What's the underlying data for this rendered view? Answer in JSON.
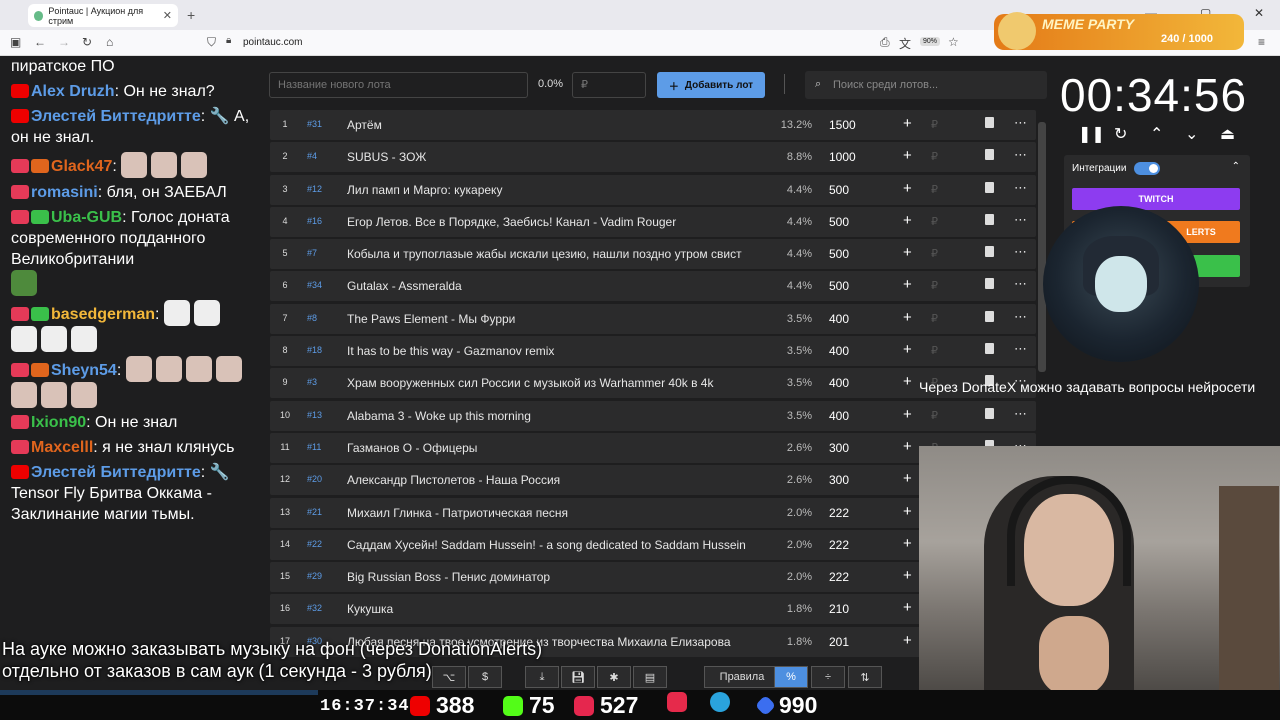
{
  "browser": {
    "tab_title": "Pointauc | Аукцион для стрим",
    "url": "pointauc.com",
    "zoom": "90%"
  },
  "chat": {
    "messages": [
      {
        "author": "",
        "text": "пиратское ПО",
        "color": "#ffffff"
      },
      {
        "author": "Alex Druzh",
        "text": "Он не знал?",
        "color": "#5d9ce7"
      },
      {
        "author": "Элестей Биттедритте",
        "text": "А, он не знал.",
        "color": "#5d9ce7"
      },
      {
        "author": "Glack47",
        "text": "",
        "color": "#e0651d"
      },
      {
        "author": "romasini",
        "text": "бля, он ЗАЕБАЛ",
        "color": "#5d9ce7"
      },
      {
        "author": "Uba-GUB",
        "text": "Голос доната современного подданного Великобритании",
        "color": "#3ac04a"
      },
      {
        "author": "basedgerman",
        "text": "",
        "color": "#f2b73a"
      },
      {
        "author": "Sheyn54",
        "text": "",
        "color": "#5d9ce7"
      },
      {
        "author": "Ixion90",
        "text": "Он не знал",
        "color": "#3ac04a"
      },
      {
        "author": "Maxcelll",
        "text": "я не знал клянусь",
        "color": "#e0651d"
      },
      {
        "author": "Элестей Биттедритте",
        "text": "Tensor Fly Бритва Оккама - Заклинание магии тьмы.",
        "color": "#5d9ce7"
      }
    ]
  },
  "toolbar": {
    "lot_placeholder": "Название нового лота",
    "percent": "0.0%",
    "amount_placeholder": "₽",
    "add_label": "Добавить лот",
    "search_placeholder": "Поиск среди лотов..."
  },
  "lots": [
    {
      "num": "1",
      "id": "#31",
      "name": "Артём",
      "pct": "13.2%",
      "amount": "1500"
    },
    {
      "num": "2",
      "id": "#4",
      "name": "SUBUS - ЗОЖ",
      "pct": "8.8%",
      "amount": "1000"
    },
    {
      "num": "3",
      "id": "#12",
      "name": "Лил памп и Марго: кукареку",
      "pct": "4.4%",
      "amount": "500"
    },
    {
      "num": "4",
      "id": "#16",
      "name": "Егор Летов. Все в Порядке, Заебись! Канал - Vadim Rouger",
      "pct": "4.4%",
      "amount": "500"
    },
    {
      "num": "5",
      "id": "#7",
      "name": "Кобыла и трупоглазые жабы искали цезию, нашли поздно утром свист",
      "pct": "4.4%",
      "amount": "500"
    },
    {
      "num": "6",
      "id": "#34",
      "name": "Gutalax - Assmeralda",
      "pct": "4.4%",
      "amount": "500"
    },
    {
      "num": "7",
      "id": "#8",
      "name": "The Paws Element - Мы Фурри",
      "pct": "3.5%",
      "amount": "400"
    },
    {
      "num": "8",
      "id": "#18",
      "name": "It has to be this way - Gazmanov remix",
      "pct": "3.5%",
      "amount": "400"
    },
    {
      "num": "9",
      "id": "#3",
      "name": "Храм вооруженных сил России с музыкой из Warhammer 40k в 4k",
      "pct": "3.5%",
      "amount": "400"
    },
    {
      "num": "10",
      "id": "#13",
      "name": "Alabama 3 - Woke up this morning",
      "pct": "3.5%",
      "amount": "400"
    },
    {
      "num": "11",
      "id": "#11",
      "name": "Газманов О - Офицеры",
      "pct": "2.6%",
      "amount": "300"
    },
    {
      "num": "12",
      "id": "#20",
      "name": "Александр Пистолетов - Наша Россия",
      "pct": "2.6%",
      "amount": "300"
    },
    {
      "num": "13",
      "id": "#21",
      "name": "Михаил Глинка - Патриотическая песня",
      "pct": "2.0%",
      "amount": "222"
    },
    {
      "num": "14",
      "id": "#22",
      "name": "Саддам Хусейн! Saddam Hussein! - a song dedicated to Saddam Hussein",
      "pct": "2.0%",
      "amount": "222"
    },
    {
      "num": "15",
      "id": "#29",
      "name": "Big Russian Boss - Пенис доминатор",
      "pct": "2.0%",
      "amount": "222"
    },
    {
      "num": "16",
      "id": "#32",
      "name": "Кукушка",
      "pct": "1.8%",
      "amount": "210"
    },
    {
      "num": "17",
      "id": "#30",
      "name": "Любая песня на твое усмотрение из творчества Михаила Елизарова",
      "pct": "1.8%",
      "amount": "201"
    }
  ],
  "bottom_bar": {
    "rules_label": "Правила"
  },
  "timer": {
    "value": "00:34:56"
  },
  "integrations": {
    "label": "Интеграции",
    "twitch_label": "TWITCH",
    "da_label": "LERTS"
  },
  "overlay": {
    "ticker": "Через DonateX можно задавать вопросы нейросети",
    "subtitle_line1": "На ауке можно заказывать музыку на фон (через DonationAlerts)",
    "subtitle_line2": "отдельно от заказов в сам аук (1 секунда - 3 рубля)",
    "meme_title": "MEME PARTY",
    "meme_count": "240 / 1000"
  },
  "statusbar": {
    "clock": "16:37:34",
    "youtube": "388",
    "kick": "75",
    "live": "527",
    "vk": "990"
  }
}
